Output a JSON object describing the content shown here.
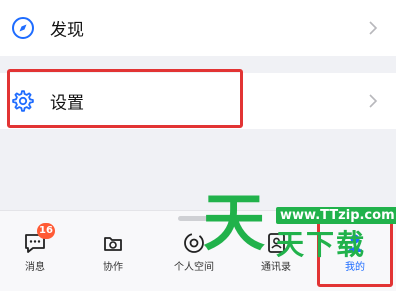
{
  "menu": {
    "discover": {
      "label": "发现",
      "icon": "compass-icon"
    },
    "settings": {
      "label": "设置",
      "icon": "gear-icon"
    }
  },
  "tabbar": {
    "items": [
      {
        "label": "消息",
        "icon": "chat-bubble-icon",
        "badge": "16",
        "active": false
      },
      {
        "label": "协作",
        "icon": "collaboration-icon",
        "active": false
      },
      {
        "label": "个人空间",
        "icon": "personal-space-icon",
        "active": false
      },
      {
        "label": "通讯录",
        "icon": "contacts-icon",
        "active": false
      },
      {
        "label": "我的",
        "icon": "profile-icon",
        "active": true
      }
    ]
  },
  "watermark": {
    "big_char": "天",
    "url": "www.TTzip.com",
    "text": "天下载"
  },
  "colors": {
    "accent": "#1e6cff",
    "highlight": "#e23434",
    "badge": "#ff5a35",
    "watermark": "#21b24b"
  }
}
